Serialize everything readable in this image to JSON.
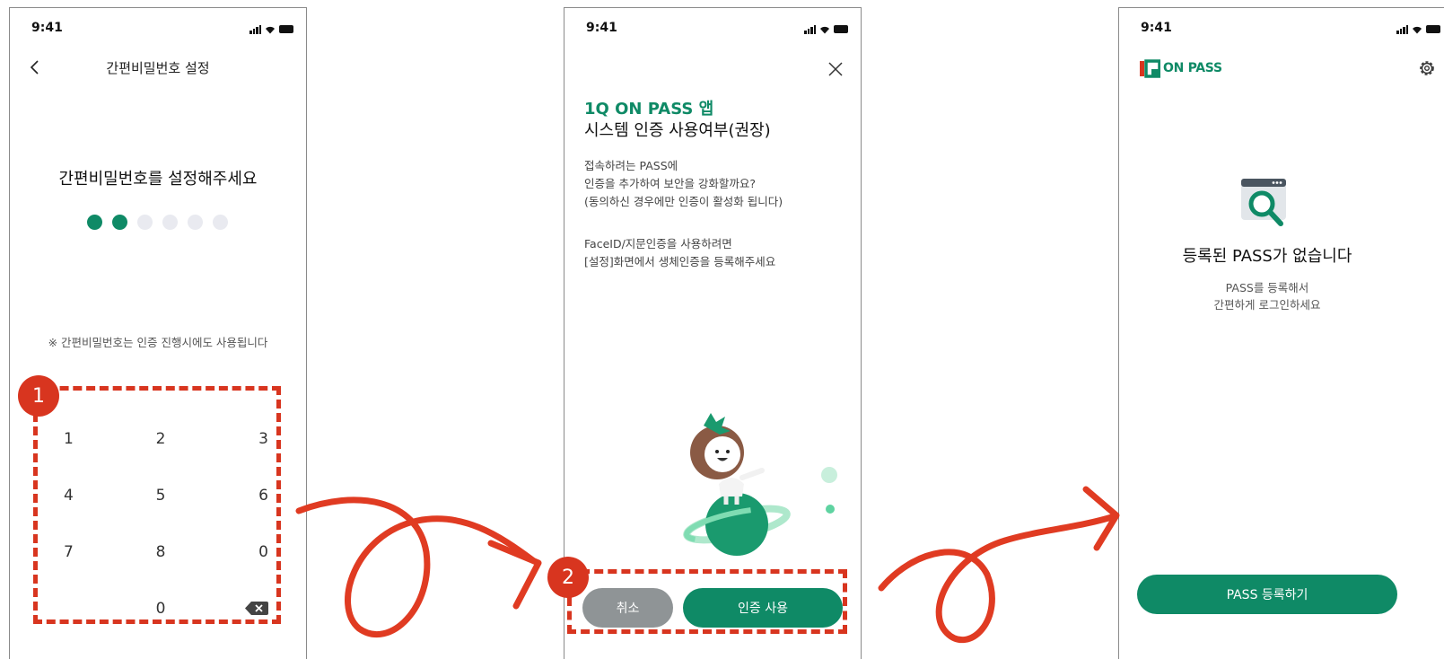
{
  "colors": {
    "accent": "#0f8a66",
    "annotation": "#d8351f",
    "cancel": "#8f9496",
    "dot_empty": "#e9eaf0"
  },
  "status_bar": {
    "time": "9:41"
  },
  "screen1": {
    "title": "간편비밀번호 설정",
    "heading": "간편비밀번호를 설정해주세요",
    "pin_entered": 2,
    "pin_length": 6,
    "note": "※ 간편비밀번호는 인증 진행시에도 사용됩니다",
    "keys": [
      "1",
      "2",
      "3",
      "4",
      "5",
      "6",
      "7",
      "8",
      "0",
      "",
      "0",
      "backspace-icon"
    ]
  },
  "screen2": {
    "title_line1": "1Q ON PASS 앱",
    "title_line2": "시스템 인증 사용여부(권장)",
    "para1": [
      "접속하려는 PASS에",
      "인증을 추가하여 보안을 강화할까요?",
      "(동의하신 경우에만 인증이 활성화 됩니다)"
    ],
    "para2": [
      "FaceID/지문인증을 사용하려면",
      "[설정]화면에서 생체인증을 등록해주세요"
    ],
    "cancel_label": "취소",
    "confirm_label": "인증 사용"
  },
  "screen3": {
    "logo_mark": "1Q",
    "logo_text": "ON PASS",
    "heading": "등록된 PASS가 없습니다",
    "sub": [
      "PASS를 등록해서",
      "간편하게 로그인하세요"
    ],
    "register_label": "PASS 등록하기"
  },
  "annotations": {
    "step1": "1",
    "step2": "2"
  }
}
